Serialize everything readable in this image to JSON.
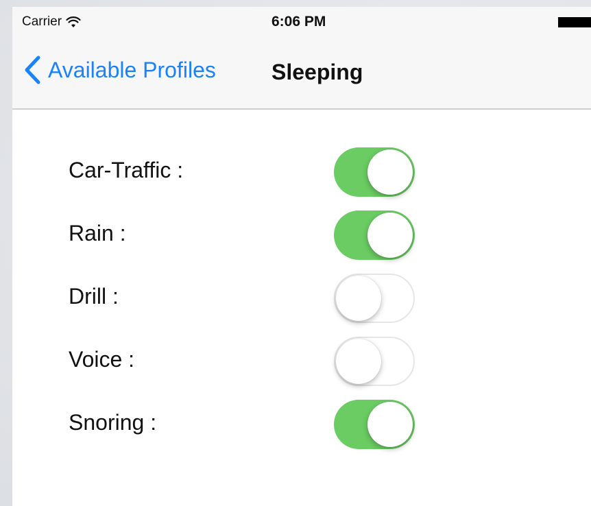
{
  "status_bar": {
    "carrier": "Carrier",
    "wifi_icon": "wifi-icon",
    "time": "6:06 PM",
    "battery_icon": "battery-icon"
  },
  "nav_bar": {
    "back_label": "Available Profiles",
    "back_icon": "chevron-left-icon",
    "title": "Sleeping",
    "tint_color": "#1a82fb"
  },
  "settings": [
    {
      "label": "Car-Traffic :",
      "enabled": true
    },
    {
      "label": "Rain :",
      "enabled": true
    },
    {
      "label": "Drill :",
      "enabled": false
    },
    {
      "label": "Voice :",
      "enabled": false
    },
    {
      "label": "Snoring :",
      "enabled": true
    }
  ],
  "colors": {
    "switch_on": "#6acc62",
    "switch_off": "#ffffff"
  }
}
